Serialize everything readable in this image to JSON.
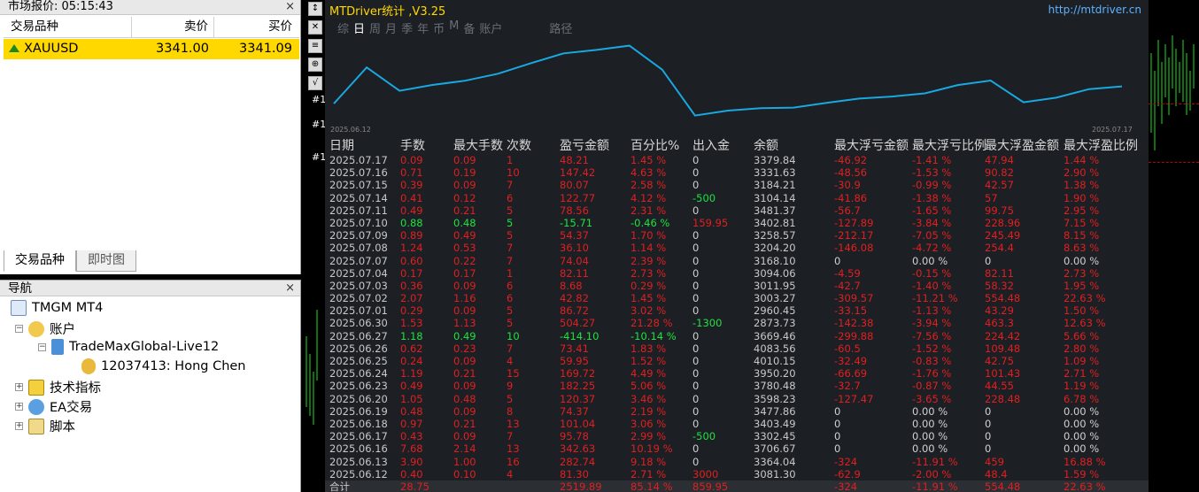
{
  "market_watch": {
    "title": "市场报价: 05:15:43",
    "headers": {
      "symbol": "交易品种",
      "bid": "卖价",
      "ask": "买价"
    },
    "rows": [
      {
        "symbol": "XAUUSD",
        "bid": "3341.00",
        "ask": "3341.09"
      }
    ],
    "tabs": [
      "交易品种",
      "即时图"
    ],
    "close": "×"
  },
  "navigator": {
    "title": "导航",
    "close": "×",
    "items": {
      "root": "TMGM MT4",
      "accounts": "账户",
      "server": "TradeMaxGlobal-Live12",
      "account": "12037413: Hong Chen",
      "indicators": "技术指标",
      "ea": "EA交易",
      "scripts": "脚本"
    }
  },
  "chart": {
    "hash_labels": [
      "#1",
      "#1",
      "#1"
    ]
  },
  "panel": {
    "title": "MTDriver统计 ,V3.25",
    "url": "http://mtdriver.cn",
    "tabs": [
      "综",
      "日",
      "周",
      "月",
      "季",
      "年",
      "币",
      "M",
      "备",
      "账户",
      "路径"
    ],
    "selected_tab": "日",
    "graph_start": "2025.06.12",
    "graph_end": "2025.07.17",
    "balance_series": [
      3081.3,
      3706.67,
      3302.45,
      3403.49,
      3477.86,
      3598.23,
      3780.48,
      3950.2,
      4010.15,
      4083.56,
      3669.46,
      2873.73,
      2960.45,
      3003.27,
      3011.95,
      3094.06,
      3168.1,
      3204.2,
      3258.57,
      3402.81,
      3481.37,
      3104.14,
      3184.21,
      3331.63,
      3379.84
    ],
    "headers": [
      "日期",
      "手数",
      "最大手数",
      "次数",
      "盈亏金额",
      "百分比%",
      "出入金",
      "余额",
      "最大浮亏金额",
      "最大浮亏比例",
      "最大浮盈金额",
      "最大浮盈比例"
    ],
    "rows": [
      [
        "2025.07.17",
        "0.09",
        "0.09",
        "1",
        "48.21",
        "1.45 %",
        "0",
        "3379.84",
        "-46.92",
        "-1.41 %",
        "47.94",
        "1.44 %"
      ],
      [
        "2025.07.16",
        "0.71",
        "0.19",
        "10",
        "147.42",
        "4.63 %",
        "0",
        "3331.63",
        "-48.56",
        "-1.53 %",
        "90.82",
        "2.90 %"
      ],
      [
        "2025.07.15",
        "0.39",
        "0.09",
        "7",
        "80.07",
        "2.58 %",
        "0",
        "3184.21",
        "-30.9",
        "-0.99 %",
        "42.57",
        "1.38 %"
      ],
      [
        "2025.07.14",
        "0.41",
        "0.12",
        "6",
        "122.77",
        "4.12 %",
        "-500",
        "3104.14",
        "-41.86",
        "-1.38 %",
        "57",
        "1.90 %"
      ],
      [
        "2025.07.11",
        "0.49",
        "0.21",
        "5",
        "78.56",
        "2.31 %",
        "0",
        "3481.37",
        "-56.7",
        "-1.65 %",
        "99.75",
        "2.95 %"
      ],
      [
        "2025.07.10",
        "0.88",
        "0.48",
        "5",
        "-15.71",
        "-0.46 %",
        "159.95",
        "3402.81",
        "-127.89",
        "-3.84 %",
        "228.96",
        "7.15 %"
      ],
      [
        "2025.07.09",
        "0.89",
        "0.49",
        "5",
        "54.37",
        "1.70 %",
        "0",
        "3258.57",
        "-212.17",
        "-7.05 %",
        "245.49",
        "8.15 %"
      ],
      [
        "2025.07.08",
        "1.24",
        "0.53",
        "7",
        "36.10",
        "1.14 %",
        "0",
        "3204.20",
        "-146.08",
        "-4.72 %",
        "254.4",
        "8.63 %"
      ],
      [
        "2025.07.07",
        "0.60",
        "0.22",
        "7",
        "74.04",
        "2.39 %",
        "0",
        "3168.10",
        "0",
        "0.00 %",
        "0",
        "0.00 %"
      ],
      [
        "2025.07.04",
        "0.17",
        "0.17",
        "1",
        "82.11",
        "2.73 %",
        "0",
        "3094.06",
        "-4.59",
        "-0.15 %",
        "82.11",
        "2.73 %"
      ],
      [
        "2025.07.03",
        "0.36",
        "0.09",
        "6",
        "8.68",
        "0.29 %",
        "0",
        "3011.95",
        "-42.7",
        "-1.40 %",
        "58.32",
        "1.95 %"
      ],
      [
        "2025.07.02",
        "2.07",
        "1.16",
        "6",
        "42.82",
        "1.45 %",
        "0",
        "3003.27",
        "-309.57",
        "-11.21 %",
        "554.48",
        "22.63 %"
      ],
      [
        "2025.07.01",
        "0.29",
        "0.09",
        "5",
        "86.72",
        "3.02 %",
        "0",
        "2960.45",
        "-33.15",
        "-1.13 %",
        "43.29",
        "1.50 %"
      ],
      [
        "2025.06.30",
        "1.53",
        "1.13",
        "5",
        "504.27",
        "21.28 %",
        "-1300",
        "2873.73",
        "-142.38",
        "-3.94 %",
        "463.3",
        "12.63 %"
      ],
      [
        "2025.06.27",
        "1.18",
        "0.49",
        "10",
        "-414.10",
        "-10.14 %",
        "0",
        "3669.46",
        "-299.88",
        "-7.56 %",
        "224.42",
        "5.66 %"
      ],
      [
        "2025.06.26",
        "0.62",
        "0.23",
        "7",
        "73.41",
        "1.83 %",
        "0",
        "4083.56",
        "-60.5",
        "-1.52 %",
        "109.48",
        "2.80 %"
      ],
      [
        "2025.06.25",
        "0.24",
        "0.09",
        "4",
        "59.95",
        "1.52 %",
        "0",
        "4010.15",
        "-32.49",
        "-0.83 %",
        "42.75",
        "1.09 %"
      ],
      [
        "2025.06.24",
        "1.19",
        "0.21",
        "15",
        "169.72",
        "4.49 %",
        "0",
        "3950.20",
        "-66.69",
        "-1.76 %",
        "101.43",
        "2.71 %"
      ],
      [
        "2025.06.23",
        "0.49",
        "0.09",
        "9",
        "182.25",
        "5.06 %",
        "0",
        "3780.48",
        "-32.7",
        "-0.87 %",
        "44.55",
        "1.19 %"
      ],
      [
        "2025.06.20",
        "1.05",
        "0.48",
        "5",
        "120.37",
        "3.46 %",
        "0",
        "3598.23",
        "-127.47",
        "-3.65 %",
        "228.48",
        "6.78 %"
      ],
      [
        "2025.06.19",
        "0.48",
        "0.09",
        "8",
        "74.37",
        "2.19 %",
        "0",
        "3477.86",
        "0",
        "0.00 %",
        "0",
        "0.00 %"
      ],
      [
        "2025.06.18",
        "0.97",
        "0.21",
        "13",
        "101.04",
        "3.06 %",
        "0",
        "3403.49",
        "0",
        "0.00 %",
        "0",
        "0.00 %"
      ],
      [
        "2025.06.17",
        "0.43",
        "0.09",
        "7",
        "95.78",
        "2.99 %",
        "-500",
        "3302.45",
        "0",
        "0.00 %",
        "0",
        "0.00 %"
      ],
      [
        "2025.06.16",
        "7.68",
        "2.14",
        "13",
        "342.63",
        "10.19 %",
        "0",
        "3706.67",
        "0",
        "0.00 %",
        "0",
        "0.00 %"
      ],
      [
        "2025.06.13",
        "3.90",
        "1.00",
        "16",
        "282.74",
        "9.18 %",
        "0",
        "3364.04",
        "-324",
        "-11.91 %",
        "459",
        "16.88 %"
      ],
      [
        "2025.06.12",
        "0.40",
        "0.10",
        "4",
        "81.30",
        "2.71 %",
        "3000",
        "3081.30",
        "-62.9",
        "-2.00 %",
        "48.4",
        "1.59 %"
      ]
    ],
    "total": [
      "合计",
      "28.75",
      "",
      "",
      "2519.89",
      "85.14 %",
      "859.95",
      "",
      "-324",
      "-11.91 %",
      "554.48",
      "22.63 %"
    ],
    "colors": {
      "profit": "#e02020",
      "loss": "#20e040",
      "neutral": "#c8c8c8",
      "line": "#19a8e0",
      "title": "#ffd800",
      "url": "#5fb2ff"
    }
  }
}
